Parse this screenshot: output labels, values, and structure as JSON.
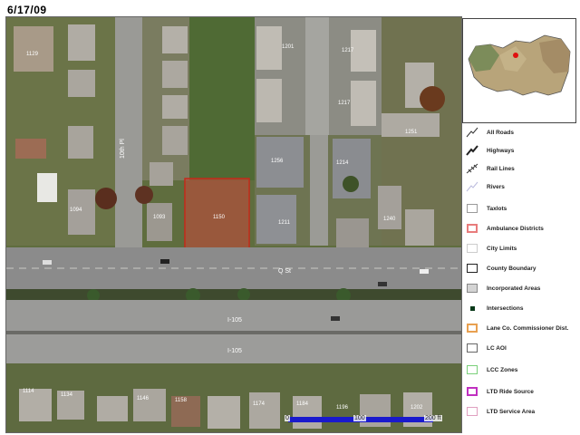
{
  "header": {
    "text": "6/17/09"
  },
  "map": {
    "road_labels": {
      "q_st": "Q St",
      "i105_upper": "I-105",
      "i105_lower": "I-105",
      "side_street": "10th Pl"
    },
    "lot_labels": {
      "subject": "1150",
      "l1129": "1129",
      "l1201": "1201",
      "l1217a": "1217",
      "l1217b": "1217",
      "l1251": "1251",
      "l1256": "1256",
      "l1214": "1214",
      "l1211": "1211",
      "l1240": "1240",
      "l1094": "1094",
      "l1093": "1093",
      "l1114": "1114",
      "l1134": "1134",
      "l1146": "1146",
      "l1158": "1158",
      "l1174": "1174",
      "l1184": "1184",
      "l1196": "1196",
      "l1202": "1202"
    },
    "scale_labels": {
      "zero": "0",
      "mid": "100",
      "end": "200 ft"
    }
  },
  "legend": [
    {
      "icon": "all-roads-icon",
      "label": "All Roads"
    },
    {
      "icon": "highways-icon",
      "label": "Highways"
    },
    {
      "icon": "rail-lines-icon",
      "label": "Rail Lines"
    },
    {
      "icon": "rivers-icon",
      "label": "Rivers"
    },
    {
      "icon": "taxlots-icon",
      "label": "Taxlots",
      "color": "#9a9a9a"
    },
    {
      "icon": "ambulance-districts-icon",
      "label": "Ambulance Districts",
      "color": "#e87c7c"
    },
    {
      "icon": "city-limits-icon",
      "label": "City Limits",
      "color": "#cccccc"
    },
    {
      "icon": "county-boundary-icon",
      "label": "County Boundary",
      "color": "#222222"
    },
    {
      "icon": "incorporated-areas-icon",
      "label": "Incorporated Areas",
      "color": "#d4d4d4"
    },
    {
      "icon": "intersections-icon",
      "label": "Intersections",
      "color": "#0a3a1a"
    },
    {
      "icon": "commissioner-dist-icon",
      "label": "Lane Co. Commissioner Dist.",
      "color": "#e8a050"
    },
    {
      "icon": "lc-aoi-icon",
      "label": "LC AOI",
      "color": "#666666"
    },
    {
      "icon": "lcc-zones-icon",
      "label": "LCC Zones",
      "color": "#7ad07a"
    },
    {
      "icon": "ltd-ride-source-icon",
      "label": "LTD Ride Source",
      "color": "#c030c0"
    },
    {
      "icon": "ltd-service-area-icon",
      "label": "LTD Service Area",
      "color": "#e0a0c0"
    }
  ]
}
